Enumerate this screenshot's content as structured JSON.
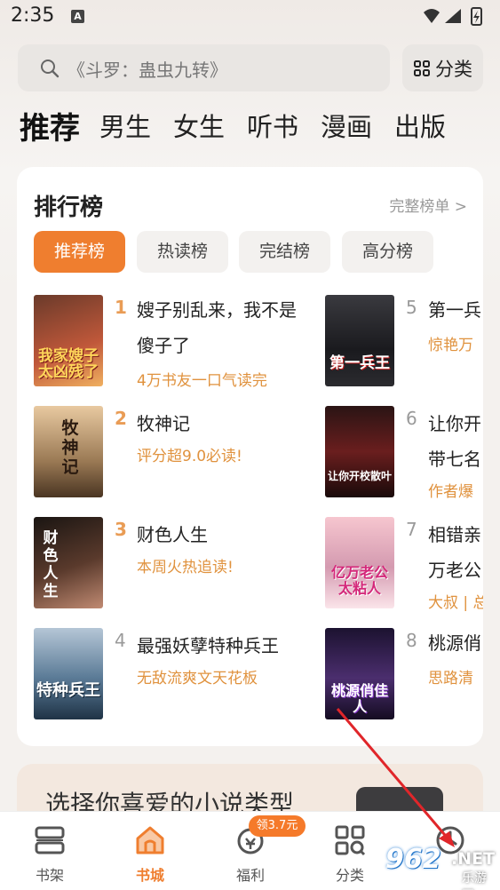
{
  "status": {
    "time": "2:35",
    "a_badge": "A"
  },
  "search": {
    "placeholder": "《斗罗：蛊虫九转》",
    "category_label": "分类"
  },
  "tabs": [
    "推荐",
    "男生",
    "女生",
    "听书",
    "漫画",
    "出版"
  ],
  "ranking": {
    "title": "排行榜",
    "more": "完整榜单 >",
    "chips": [
      "推荐榜",
      "热读榜",
      "完结榜",
      "高分榜"
    ],
    "books": [
      {
        "rank": "1",
        "name": "嫂子别乱来，我不是傻子了",
        "tag": "4万书友一口气读完",
        "cover_text": "我家嫂子太凶残了"
      },
      {
        "rank": "2",
        "name": "牧神记",
        "tag": "评分超9.0必读!",
        "cover_text": "牧神记"
      },
      {
        "rank": "3",
        "name": "财色人生",
        "tag": "本周火热追读!",
        "cover_text": "财色人生"
      },
      {
        "rank": "4",
        "name": "最强妖孽特种兵王",
        "tag": "无敌流爽文天花板",
        "cover_text": "特种兵王"
      },
      {
        "rank": "5",
        "name": "第一兵",
        "tag": "惊艳万",
        "cover_text": "第一兵王"
      },
      {
        "rank": "6",
        "name": "让你开带七名",
        "tag": "作者爆",
        "cover_text": "让你开校散叶"
      },
      {
        "rank": "7",
        "name": "相错亲万老公",
        "tag": "大叔 | 总",
        "cover_text": "亿万老公太粘人"
      },
      {
        "rank": "8",
        "name": "桃源俏",
        "tag": "思路清",
        "cover_text": "桃源俏佳人"
      }
    ]
  },
  "promo": {
    "text": "选择你喜爱的小说类型"
  },
  "bottom_nav": [
    {
      "label": "书架",
      "icon": "bookshelf-icon"
    },
    {
      "label": "书城",
      "icon": "bookstore-icon"
    },
    {
      "label": "福利",
      "icon": "gift-icon"
    },
    {
      "label": "分类",
      "icon": "category-icon"
    },
    {
      "label": "",
      "icon": "clock-icon"
    }
  ],
  "welfare_badge": "领3.7元",
  "watermark": {
    "num": "962",
    "net": ".NET",
    "cn": "乐游网"
  },
  "colors": {
    "accent": "#ef7e2f",
    "tag": "#e0923e",
    "rank": "#e99c55"
  }
}
